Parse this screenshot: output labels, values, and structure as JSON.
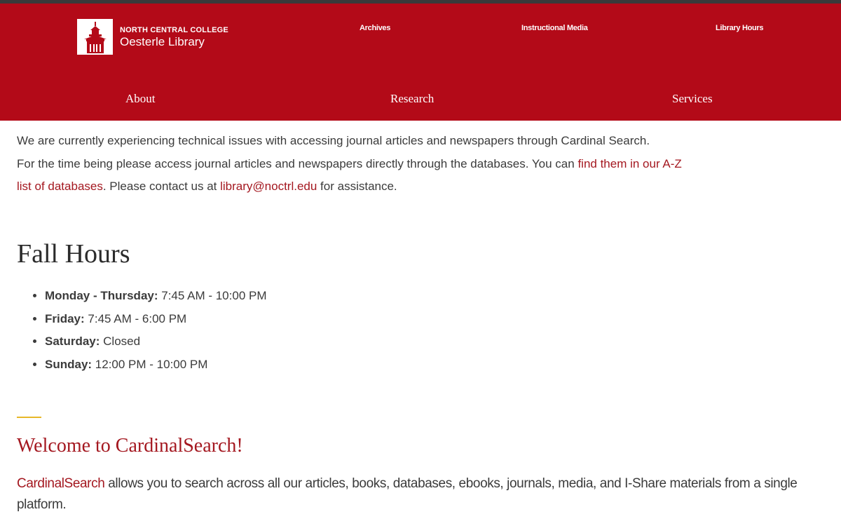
{
  "header": {
    "logo": {
      "line1": "NORTH CENTRAL COLLEGE",
      "line2": "Oesterle Library"
    },
    "utility_links": [
      "Archives",
      "Instructional Media",
      "Library Hours"
    ],
    "main_nav": [
      "About",
      "Research",
      "Services"
    ],
    "colors": {
      "brand_red": "#b30a18",
      "top_bar": "#3a3a3a"
    }
  },
  "alert": {
    "line1": "We are currently experiencing technical issues with accessing journal articles and newspapers through Cardinal Search.",
    "line2_text": "For the time being please access journal articles and newspapers directly through the databases. You can ",
    "link_text": "find them in our A-Z list of databases",
    "mid_text": ". Please contact us at ",
    "email": "library@noctrl.edu",
    "end_text": " for assistance."
  },
  "hours": {
    "title": "Fall Hours",
    "items": [
      {
        "day": "Monday - Thursday:",
        "time": "7:45 AM - 10:00 PM"
      },
      {
        "day": "Friday:",
        "time": "7:45 AM - 6:00 PM"
      },
      {
        "day": "Saturday:",
        "time": "Closed"
      },
      {
        "day": "Sunday:",
        "time": "12:00 PM - 10:00 PM"
      }
    ]
  },
  "welcome": {
    "title": "Welcome to CardinalSearch!",
    "link": "CardinalSearch",
    "text": " allows you to search across all our articles, books, databases, ebooks, journals, media, and I-Share materials from a single platform.",
    "accent_color": "#e7b82a"
  }
}
